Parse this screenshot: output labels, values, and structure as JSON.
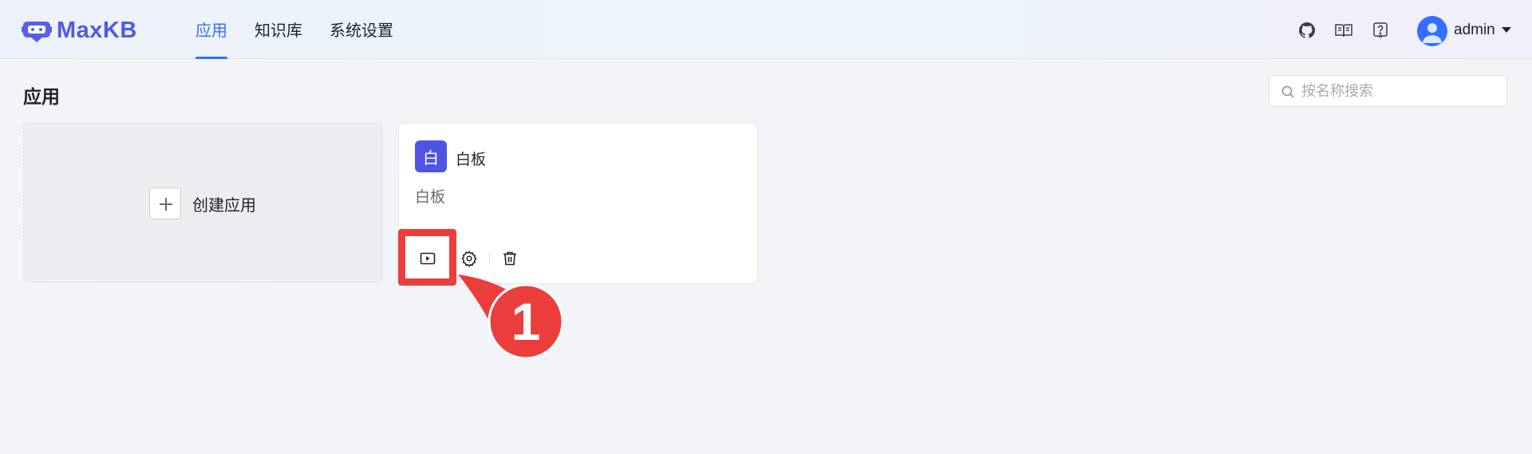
{
  "brand": {
    "name": "MaxKB",
    "color": "#4c5ce8"
  },
  "nav": {
    "items": [
      {
        "label": "应用",
        "active": true
      },
      {
        "label": "知识库",
        "active": false
      },
      {
        "label": "系统设置",
        "active": false
      }
    ],
    "active_color": "#3370ff"
  },
  "header": {
    "icons": [
      "github-icon",
      "book-icon",
      "help-icon"
    ],
    "user": {
      "name": "admin",
      "avatar": "user-avatar-icon"
    }
  },
  "page": {
    "title": "应用"
  },
  "search": {
    "placeholder": "按名称搜索",
    "value": ""
  },
  "create_card": {
    "label": "创建应用",
    "icon": "plus-icon"
  },
  "apps": [
    {
      "avatar_text": "白",
      "avatar_color": "#4f55e2",
      "name": "白板",
      "description": "白板",
      "actions": [
        "play-icon",
        "gear-icon",
        "trash-icon"
      ]
    }
  ],
  "annotation": {
    "number": "1",
    "color": "#ec3d3d"
  }
}
